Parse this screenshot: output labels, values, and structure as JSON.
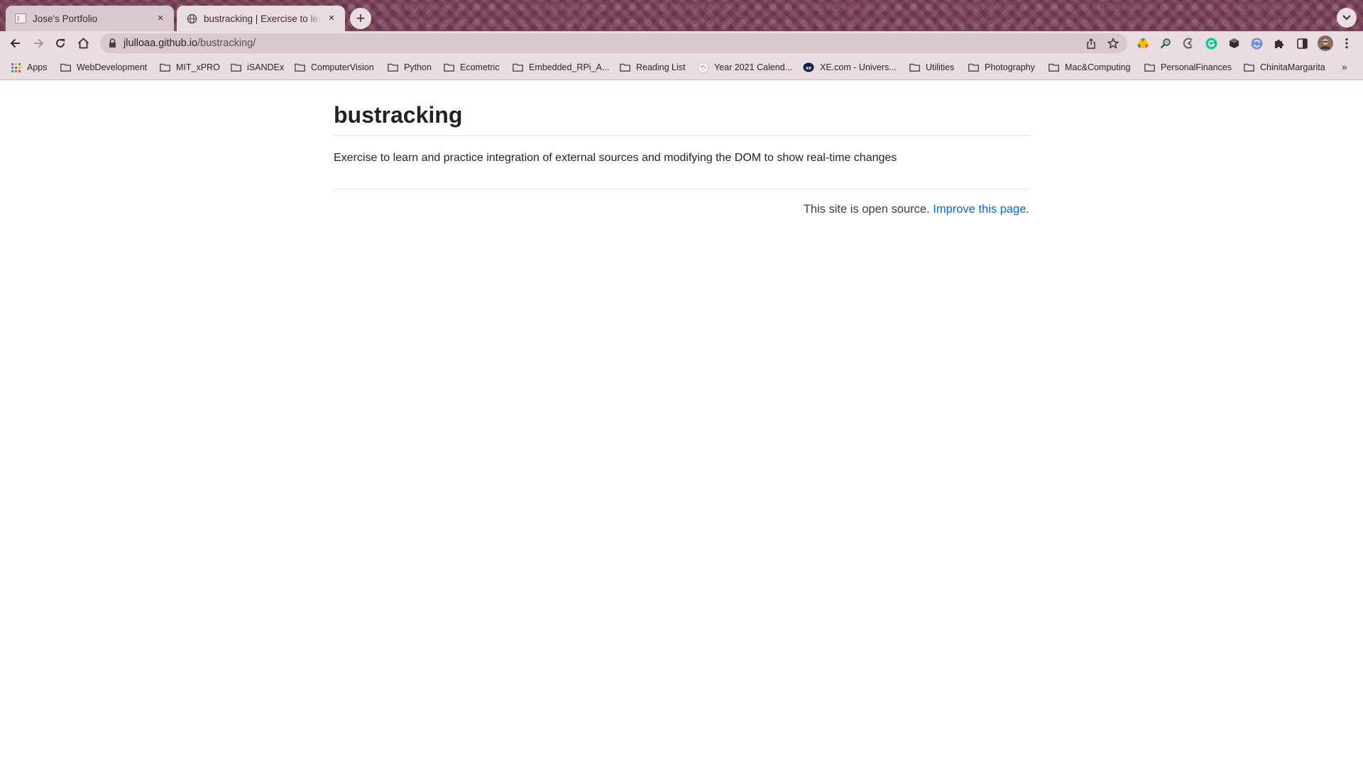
{
  "browser": {
    "tabs": [
      {
        "title": "Jose's Portfolio",
        "close": "×"
      },
      {
        "title": "bustracking | Exercise to learn and practice integration of external sources",
        "close": "×"
      }
    ],
    "new_tab": "+",
    "url_host": "jlulloaa.github.io",
    "url_path": "/bustracking/",
    "bookmarks": [
      {
        "label": "Apps",
        "icon": "apps-grid-icon"
      },
      {
        "label": "WebDevelopment",
        "icon": "folder-icon"
      },
      {
        "label": "MIT_xPRO",
        "icon": "folder-icon"
      },
      {
        "label": "iSANDEx",
        "icon": "folder-icon"
      },
      {
        "label": "ComputerVision",
        "icon": "folder-icon"
      },
      {
        "label": "Python",
        "icon": "folder-icon"
      },
      {
        "label": "Ecometric",
        "icon": "folder-icon"
      },
      {
        "label": "Embedded_RPi_A...",
        "icon": "folder-icon"
      },
      {
        "label": "Reading List",
        "icon": "folder-icon"
      },
      {
        "label": "Year 2021 Calend...",
        "icon": "calendar-site-icon"
      },
      {
        "label": "XE.com - Univers...",
        "icon": "xe-logo-icon"
      },
      {
        "label": "Utilities",
        "icon": "folder-icon"
      },
      {
        "label": "Photography",
        "icon": "folder-icon"
      },
      {
        "label": "Mac&Computing",
        "icon": "folder-icon"
      },
      {
        "label": "PersonalFinances",
        "icon": "folder-icon"
      },
      {
        "label": "ChinitaMargarita",
        "icon": "folder-icon"
      }
    ],
    "bookmarks_more": "»",
    "colors": {
      "frame": "#7a3f58",
      "toolbar": "#e9dde2",
      "omnibox": "#d7c9cf",
      "link": "#0969da"
    }
  },
  "page": {
    "title": "bustracking",
    "description": "Exercise to learn and practice integration of external sources and modifying the DOM to show real-time changes",
    "footer_text": "This site is open source.",
    "footer_link": "Improve this page",
    "footer_end": "."
  }
}
